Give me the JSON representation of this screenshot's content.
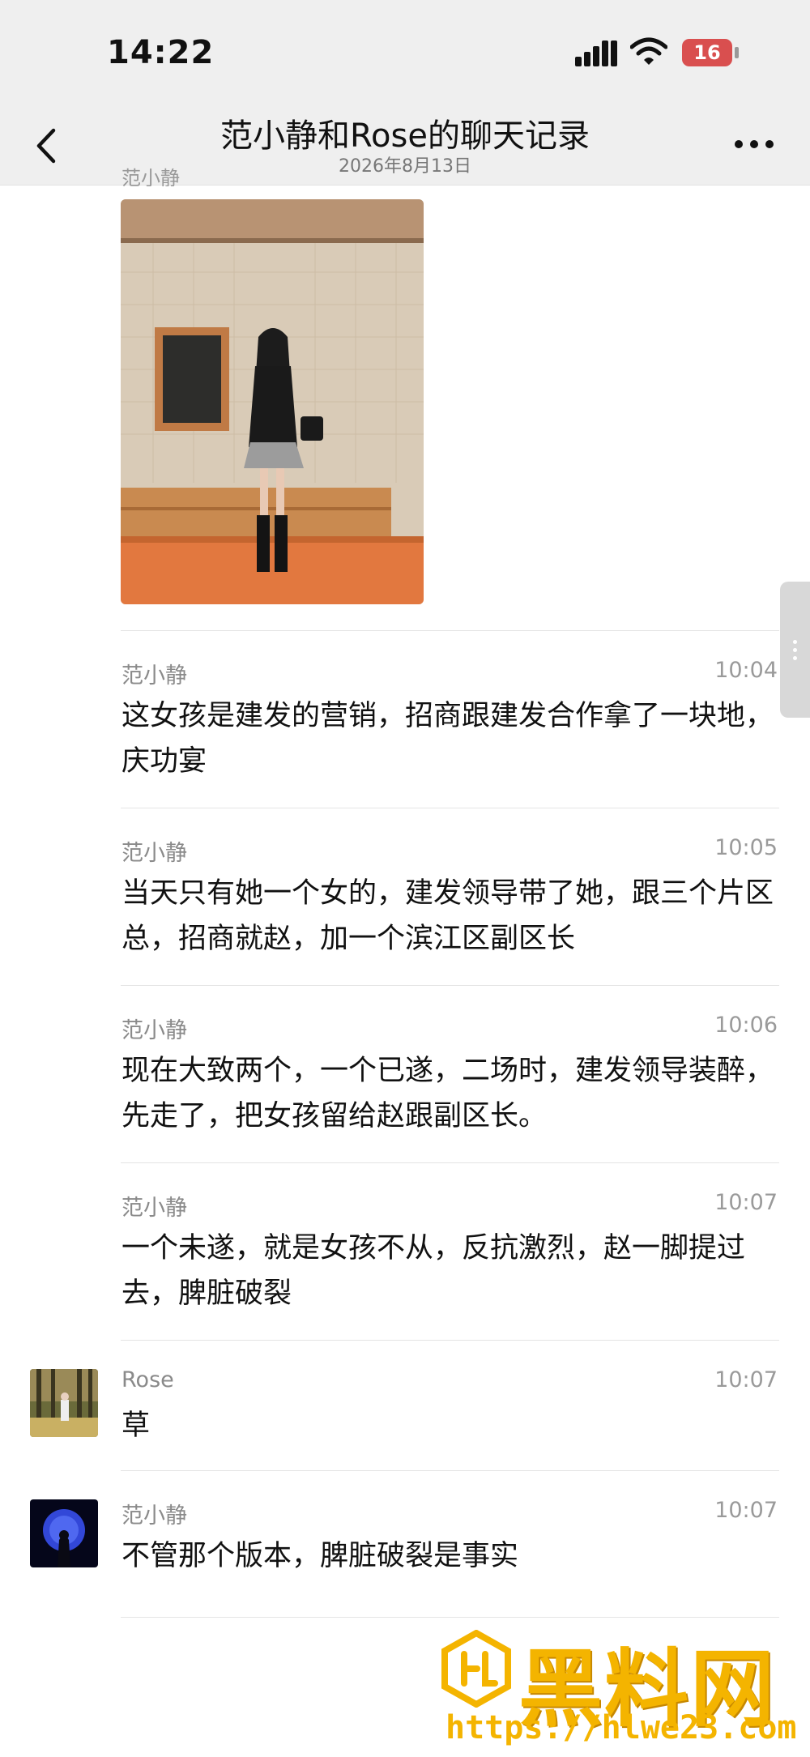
{
  "status_bar": {
    "time": "14:22",
    "battery": "16"
  },
  "nav": {
    "title": "范小静和Rose的聊天记录",
    "subtitle": "2026年8月13日"
  },
  "photo_message": {
    "sender_partial": "范小静"
  },
  "messages": [
    {
      "sender": "范小静",
      "time": "10:04",
      "text": "这女孩是建发的营销，招商跟建发合作拿了一块地，庆功宴"
    },
    {
      "sender": "范小静",
      "time": "10:05",
      "text": "当天只有她一个女的，建发领导带了她，跟三个片区总，招商就赵，加一个滨江区副区长"
    },
    {
      "sender": "范小静",
      "time": "10:06",
      "text": "现在大致两个，一个已遂，二场时，建发领导装醉，先走了，把女孩留给赵跟副区长。"
    },
    {
      "sender": "范小静",
      "time": "10:07",
      "text": "一个未遂，就是女孩不从，反抗激烈，赵一脚提过去，脾脏破裂"
    },
    {
      "sender": "Rose",
      "time": "10:07",
      "text": "草"
    },
    {
      "sender": "范小静",
      "time": "10:07",
      "text": "不管那个版本，脾脏破裂是事实"
    }
  ],
  "watermark": {
    "title": "黑料网",
    "url": "https://hlwe23.com"
  }
}
